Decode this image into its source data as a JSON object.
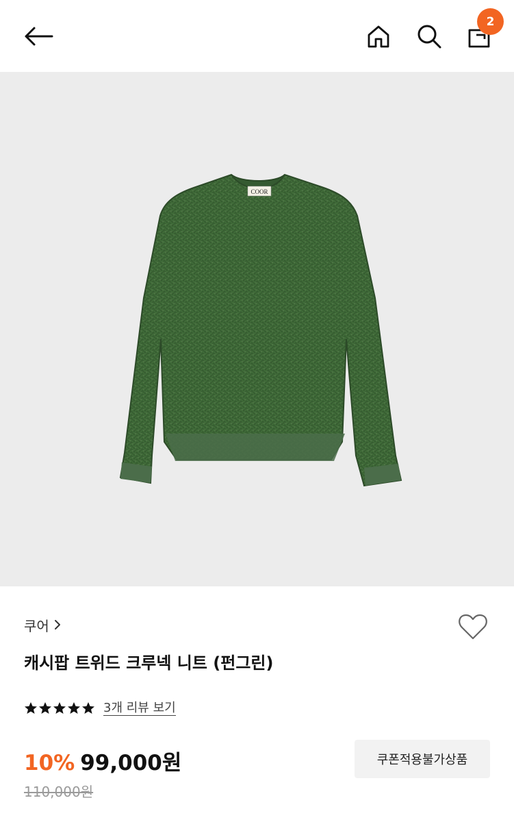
{
  "header": {
    "icons": {
      "back": "arrow-left-icon",
      "home": "home-icon",
      "search": "search-icon",
      "cart": "shopping-bag-icon"
    },
    "cart_count": "2",
    "badge_color": "#f26522"
  },
  "product": {
    "image_label": "COOR",
    "sweater_color": "#3f6a38",
    "brand": "쿠어",
    "title": "캐시팝 트위드 크루넥 니트 (펀그린)",
    "rating": {
      "stars_filled": 5,
      "stars_total": 5
    },
    "review_link": "3개 리뷰 보기",
    "discount": "10%",
    "price": "99,000원",
    "original_price": "110,000원",
    "coupon_notice": "쿠폰적용불가상품",
    "accent_color": "#f26522"
  }
}
